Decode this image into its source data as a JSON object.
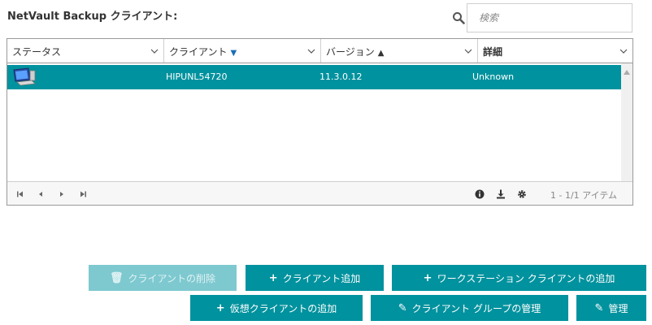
{
  "page": {
    "title": "NetVault Backup クライアント:"
  },
  "search": {
    "placeholder": "検索"
  },
  "grid": {
    "columns": [
      {
        "label": "ステータス",
        "sort": ""
      },
      {
        "label": "クライアント",
        "sort": "▼"
      },
      {
        "label": "バージョン",
        "sort": "▲"
      },
      {
        "label": "詳細",
        "sort": ""
      }
    ],
    "rows": [
      {
        "client": "HIPUNL54720",
        "version": "11.3.0.12",
        "details": "Unknown",
        "status_icon": "computer-icon"
      }
    ]
  },
  "pager": {
    "items_text": "1 - 1/1 アイテム"
  },
  "buttons": {
    "remove": {
      "label": "クライアントの削除",
      "icon": "trash-icon"
    },
    "add_client": {
      "label": "クライアント追加",
      "icon": "plus-icon"
    },
    "add_workstation": {
      "label": "ワークステーション クライアントの追加",
      "icon": "plus-icon"
    },
    "add_virtual": {
      "label": "仮想クライアントの追加",
      "icon": "plus-icon"
    },
    "manage_groups": {
      "label": "クライアント グループの管理",
      "icon": "edit-icon"
    },
    "manage": {
      "label": "管理",
      "icon": "edit-icon"
    }
  },
  "colors": {
    "accent": "#00929e",
    "accent_disabled": "#7ec9d0",
    "sort_arrow": "#1b6eb6"
  }
}
